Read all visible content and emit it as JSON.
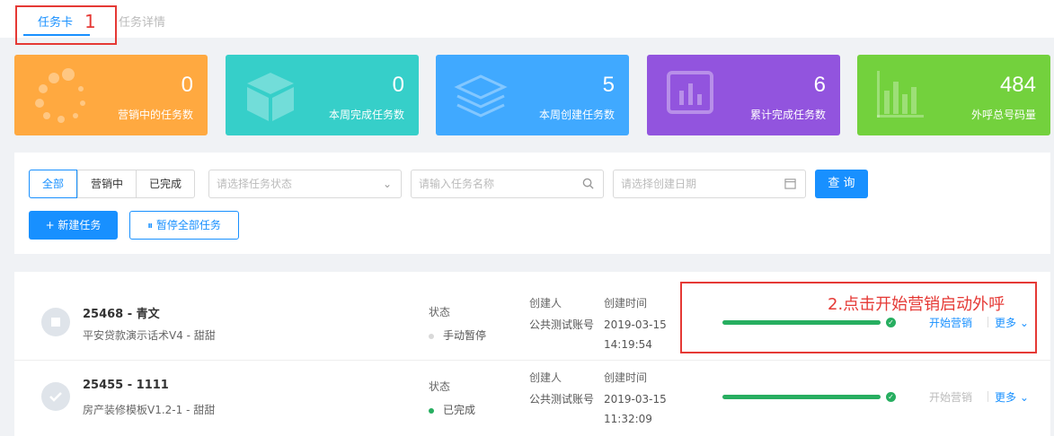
{
  "tabs": [
    {
      "label": "任务卡",
      "active": true
    },
    {
      "label": "任务详情",
      "active": false
    }
  ],
  "annotations": {
    "num1": "1",
    "text2": "2.点击开始营销启动外呼"
  },
  "stats": [
    {
      "value": "0",
      "label": "营销中的任务数",
      "color": "#ffa940",
      "icon": "spinner-icon"
    },
    {
      "value": "0",
      "label": "本周完成任务数",
      "color": "#36cfc9",
      "icon": "cube-icon"
    },
    {
      "value": "5",
      "label": "本周创建任务数",
      "color": "#40a9ff",
      "icon": "layers-icon"
    },
    {
      "value": "6",
      "label": "累计完成任务数",
      "color": "#9254de",
      "icon": "chart-box-icon"
    },
    {
      "value": "484",
      "label": "外呼总号码量",
      "color": "#73d13d",
      "icon": "bar-chart-icon"
    }
  ],
  "filters": {
    "segments": [
      "全部",
      "营销中",
      "已完成"
    ],
    "status_placeholder": "请选择任务状态",
    "name_placeholder": "请输入任务名称",
    "date_placeholder": "请选择创建日期",
    "query_label": "查 询",
    "new_task_label": "+ 新建任务",
    "pause_all_label": "⏸ 暂停全部任务"
  },
  "tasks": [
    {
      "title": "25468 - 青文",
      "subtitle": "平安贷款演示话术V4 - 甜甜",
      "status_header": "状态",
      "status": "手动暂停",
      "status_color": "#d9d9d9",
      "creator_header": "创建人",
      "creator": "公共测试账号",
      "time_header": "创建时间",
      "time": "2019-03-15 14:19:54",
      "progress": 1.0,
      "action": "开始营销",
      "action_enabled": true,
      "more": "更多 ⌄"
    },
    {
      "title": "25455 - 1111",
      "subtitle": "房产装修模板V1.2-1 - 甜甜",
      "status_header": "状态",
      "status": "已完成",
      "status_color": "#27ae60",
      "creator_header": "创建人",
      "creator": "公共测试账号",
      "time_header": "创建时间",
      "time": "2019-03-15 11:32:09",
      "progress": 1.0,
      "action": "开始营销",
      "action_enabled": false,
      "more": "更多 ⌄"
    }
  ]
}
